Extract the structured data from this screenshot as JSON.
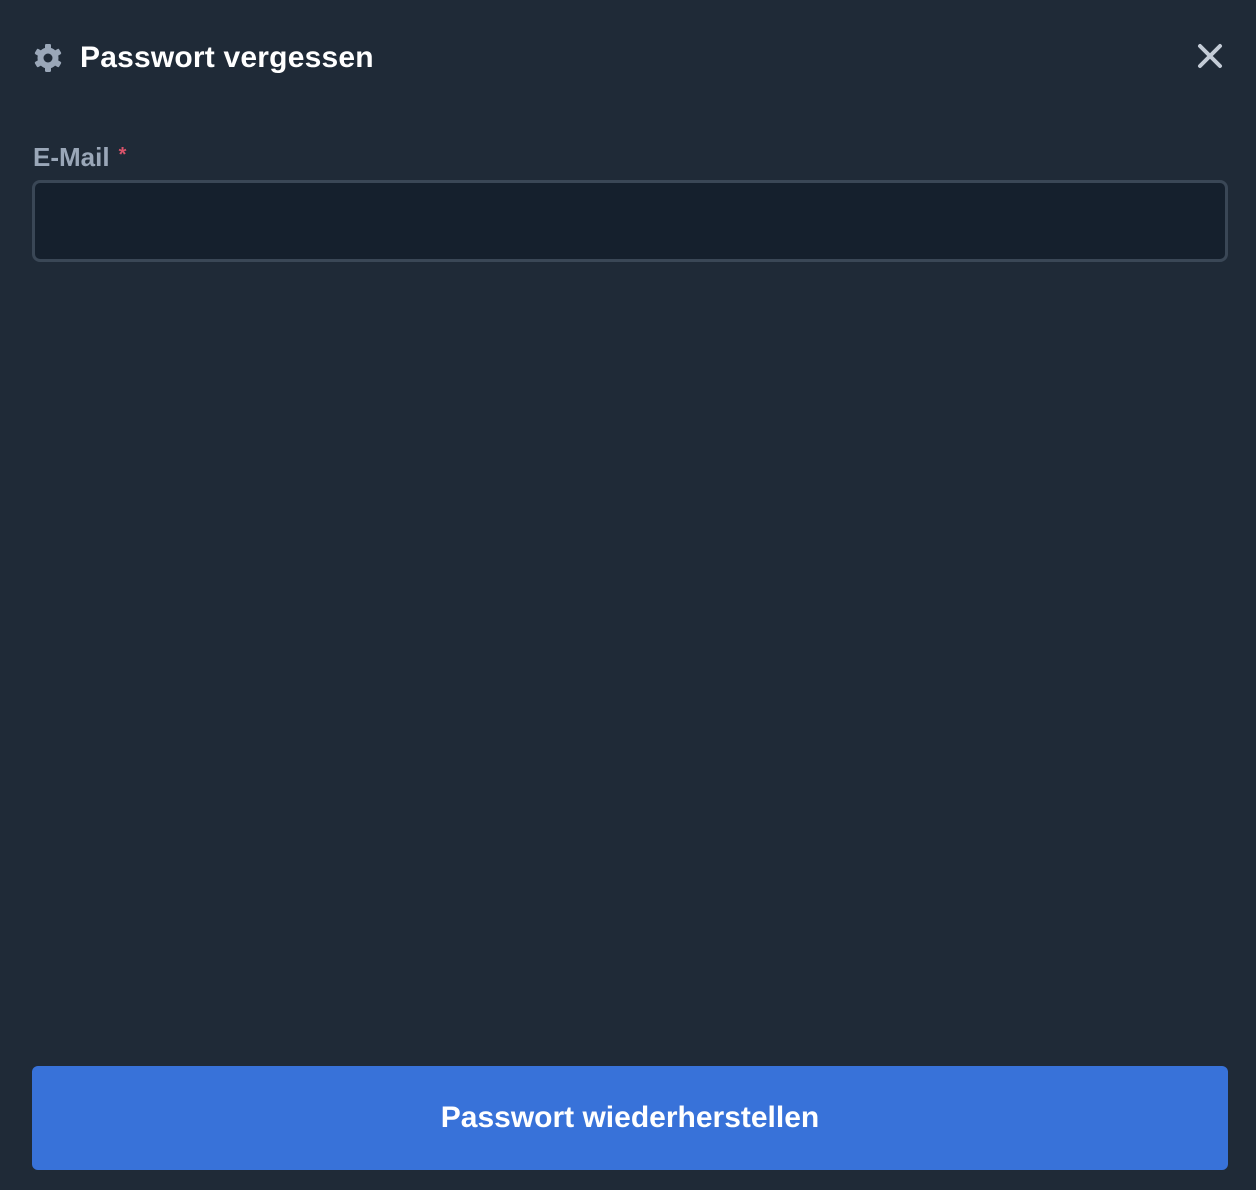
{
  "dialog": {
    "title": "Passwort vergessen",
    "title_icon": "gear-icon",
    "close_icon": "close-icon"
  },
  "form": {
    "email_label": "E-Mail",
    "required_marker": "*",
    "email_value": "",
    "email_placeholder": ""
  },
  "actions": {
    "submit_label": "Passwort wiederherstellen"
  },
  "colors": {
    "background": "#1f2a37",
    "input_background": "#15202d",
    "input_border": "#3a4756",
    "label": "#9aa7b8",
    "required": "#d9536a",
    "primary_button": "#3872d9",
    "icon": "#9aa7b8"
  }
}
